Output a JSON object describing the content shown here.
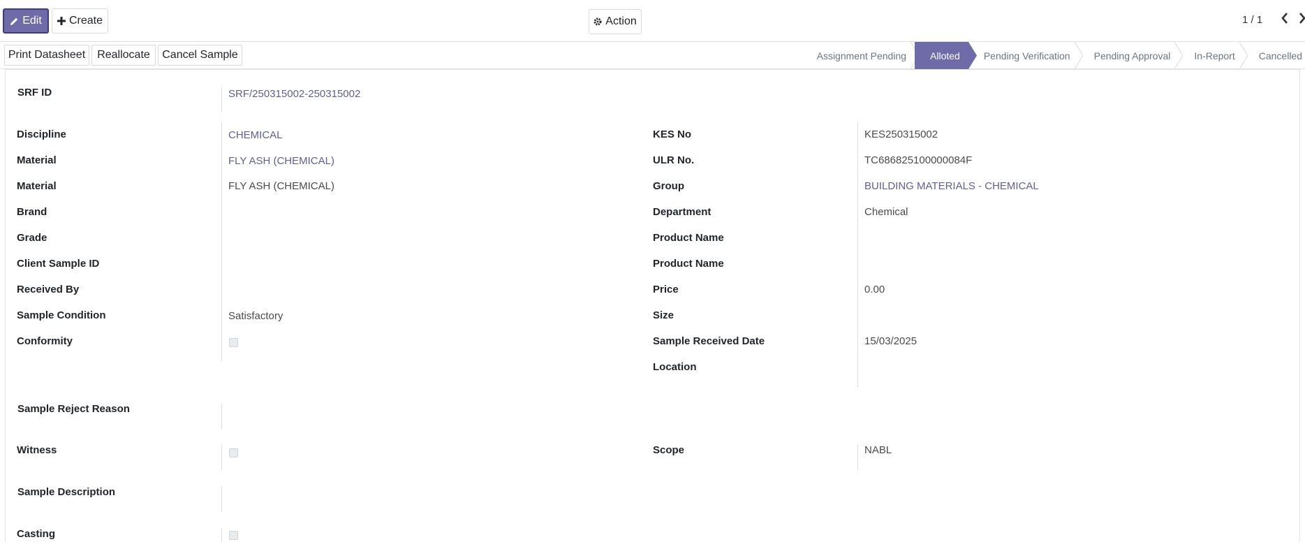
{
  "toolbar": {
    "edit_label": "Edit",
    "create_label": "Create",
    "action_label": "Action",
    "pager": "1 / 1"
  },
  "statusbar": {
    "print_label": "Print Datasheet",
    "reallocate_label": "Reallocate",
    "cancel_label": "Cancel Sample",
    "stages": [
      "Assignment Pending",
      "Alloted",
      "Pending Verification",
      "Pending Approval",
      "In-Report",
      "Cancelled"
    ],
    "active_stage": "Alloted"
  },
  "form": {
    "srf_label": "SRF ID",
    "srf_value": "SRF/250315002-250315002",
    "left": [
      {
        "label": "Discipline",
        "value": "CHEMICAL"
      },
      {
        "label": "Material",
        "value": "FLY ASH (CHEMICAL)"
      },
      {
        "label": "Material",
        "value": "FLY ASH (CHEMICAL)"
      },
      {
        "label": "Brand",
        "value": ""
      },
      {
        "label": "Grade",
        "value": ""
      },
      {
        "label": "Client Sample ID",
        "value": ""
      },
      {
        "label": "Received By",
        "value": ""
      },
      {
        "label": "Sample Condition",
        "value": "Satisfactory"
      },
      {
        "label": "Conformity",
        "value": ""
      }
    ],
    "right": [
      {
        "label": "KES No",
        "value": "KES250315002"
      },
      {
        "label": "ULR No.",
        "value": "TC686825100000084F"
      },
      {
        "label": "Group",
        "value": "BUILDING MATERIALS - CHEMICAL"
      },
      {
        "label": "Department",
        "value": "Chemical"
      },
      {
        "label": "Product Name",
        "value": ""
      },
      {
        "label": "Product Name",
        "value": ""
      },
      {
        "label": "Price",
        "value": "0.00"
      },
      {
        "label": "Size",
        "value": ""
      },
      {
        "label": "Sample Received Date",
        "value": "15/03/2025"
      },
      {
        "label": "Location",
        "value": ""
      }
    ],
    "reject_label": "Sample Reject Reason",
    "witness_label": "Witness",
    "scope_label": "Scope",
    "scope_value": "NABL",
    "description_label": "Sample Description",
    "casting_label": "Casting"
  },
  "colors": {
    "primary": "#6f6aa8",
    "link": "#5f5e97"
  },
  "icons": {
    "edit": "pencil-icon",
    "create": "plus-icon",
    "action": "gear-icon",
    "prev": "chevron-left-icon",
    "next": "chevron-right-icon"
  }
}
